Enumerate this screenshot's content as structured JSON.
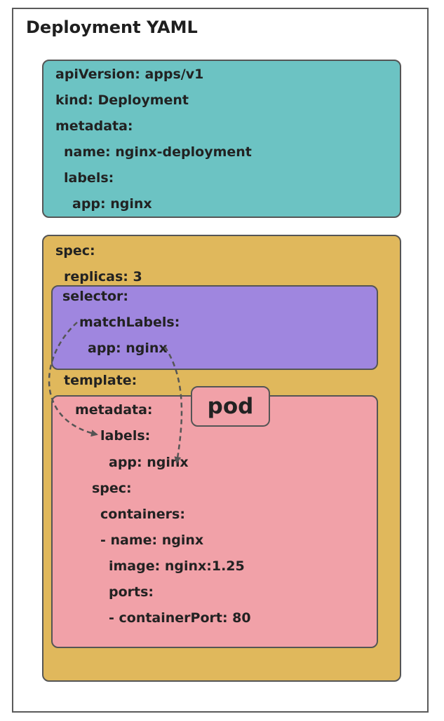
{
  "title": "Deployment YAML",
  "colors": {
    "metadata_box": "#6cc3c3",
    "spec_box": "#e0b85c",
    "selector_box": "#9f86df",
    "template_box": "#f1a1a8",
    "pod_tag": "#f1a1a8",
    "arrow": "#555555"
  },
  "header_block": {
    "api_version": "apiVersion: apps/v1",
    "kind": "kind: Deployment",
    "metadata": "metadata:",
    "name": "name: nginx-deployment",
    "labels": "labels:",
    "app": "app: nginx"
  },
  "spec_block": {
    "spec": "spec:",
    "replicas": "replicas: 3",
    "template": "template:"
  },
  "selector_block": {
    "selector": "selector:",
    "match_labels": "matchLabels:",
    "app": "app: nginx"
  },
  "template_block": {
    "pod_label": "pod",
    "metadata": "metadata:",
    "labels": "labels:",
    "app": "app: nginx",
    "spec": "spec:",
    "containers": "containers:",
    "name": "- name: nginx",
    "image": "image: nginx:1.25",
    "ports": "ports:",
    "container_port": "- containerPort: 80"
  }
}
